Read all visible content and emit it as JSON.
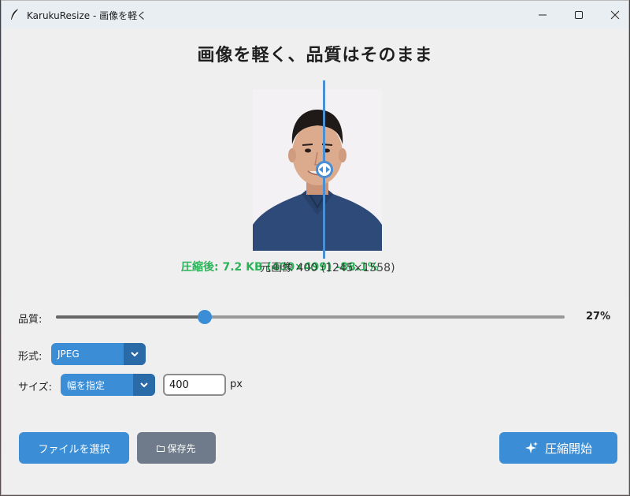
{
  "window": {
    "title": "KarukuResize - 画像を軽く"
  },
  "headline": "画像を軽く、品質はそのまま",
  "preview": {
    "compressed_label": "圧縮後: 7.2 KB (400×499) -88.1%",
    "original_label": "元画像 400 (1245×1558)"
  },
  "quality": {
    "label": "品質:",
    "value_text": "27%",
    "value": 0.27
  },
  "format": {
    "label": "形式:",
    "selected": "JPEG"
  },
  "size": {
    "label": "サイズ:",
    "selected": "幅を指定",
    "width_value": "400",
    "unit": "px"
  },
  "buttons": {
    "select_file": "ファイルを選択",
    "save_to": "保存先",
    "start": "圧縮開始"
  },
  "colors": {
    "accent": "#3b8ed6",
    "success": "#2cb35a",
    "secondary": "#6f7b8a"
  }
}
